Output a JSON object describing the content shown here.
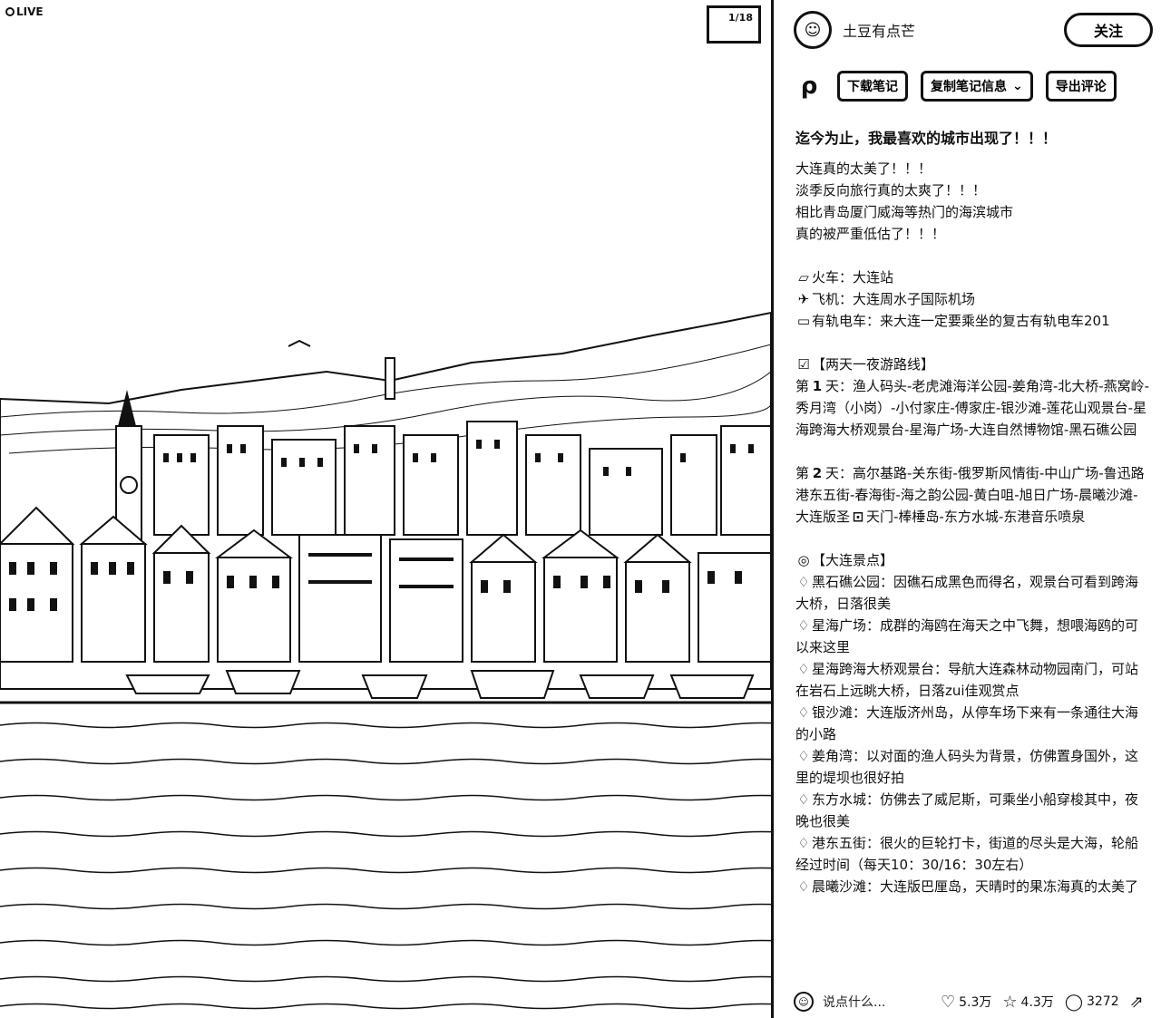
{
  "media": {
    "live_label": "LIVE",
    "page_counter": "1/18"
  },
  "author": {
    "avatar_glyph": "☺",
    "name": "土豆有点芒",
    "follow_label": "关注"
  },
  "tools": {
    "icon_glyph": "ρ",
    "download_label": "下载笔记",
    "copy_label": "复制笔记信息",
    "export_label": "导出评论"
  },
  "post": {
    "title": "迄今为止，我最喜欢的城市出现了！！！",
    "intro": [
      "大连真的太美了！！！",
      "淡季反向旅行真的太爽了！！！",
      "相比青岛厦门威海等热门的海滨城市",
      "真的被严重低估了！！！"
    ],
    "transport": [
      {
        "icon": "▱",
        "text": "火车：大连站"
      },
      {
        "icon": "✈",
        "text": "飞机：大连周水子国际机场"
      },
      {
        "icon": "▭",
        "text": "有轨电车：来大连一定要乘坐的复古有轨电车201"
      }
    ],
    "route_header": {
      "icon": "☑",
      "text": "【两天一夜游路线】"
    },
    "day1": {
      "prefix": "第",
      "num": "1",
      "text": "天：渔人码头-老虎滩海洋公园-姜角湾-北大桥-燕窝岭-秀月湾（小岗）-小付家庄-傅家庄-银沙滩-莲花山观景台-星海跨海大桥观景台-星海广场-大连自然博物馆-黑石礁公园"
    },
    "day2": {
      "prefix": "第",
      "num": "2",
      "text": "天：高尔基路-关东街-俄罗斯风情街-中山广场-鲁迅路港东五街-春海街-海之韵公园-黄白咀-旭日广场-晨曦沙滩-大连版圣",
      "icon": "⊡",
      "text2": "天门-棒棰岛-东方水城-东港音乐喷泉"
    },
    "spots_header": {
      "icon": "◎",
      "text": "【大连景点】"
    },
    "spots": [
      "黑石礁公园：因礁石成黑色而得名，观景台可看到跨海大桥，日落很美",
      "星海广场：成群的海鸥在海天之中飞舞，想喂海鸥的可以来这里",
      "星海跨海大桥观景台：导航大连森林动物园南门，可站在岩石上远眺大桥，日落zui佳观赏点",
      "银沙滩：大连版济州岛，从停车场下来有一条通往大海的小路",
      "姜角湾：以对面的渔人码头为背景，仿佛置身国外，这里的堤坝也很好拍",
      "东方水城：仿佛去了威尼斯，可乘坐小船穿梭其中，夜晚也很美",
      "港东五街：很火的巨轮打卡，街道的尽头是大海，轮船经过时间（每天10：30/16：30左右）",
      "晨曦沙滩：大连版巴厘岛，天晴时的果冻海真的太美了"
    ],
    "spot_icon": "♢"
  },
  "footer": {
    "me_glyph": "☺",
    "comment_placeholder": "说点什么...",
    "likes": "5.3万",
    "collects": "4.3万",
    "comments": "3272",
    "like_icon": "♡",
    "collect_icon": "☆",
    "comment_icon": "◯",
    "share_icon": "⇗"
  }
}
